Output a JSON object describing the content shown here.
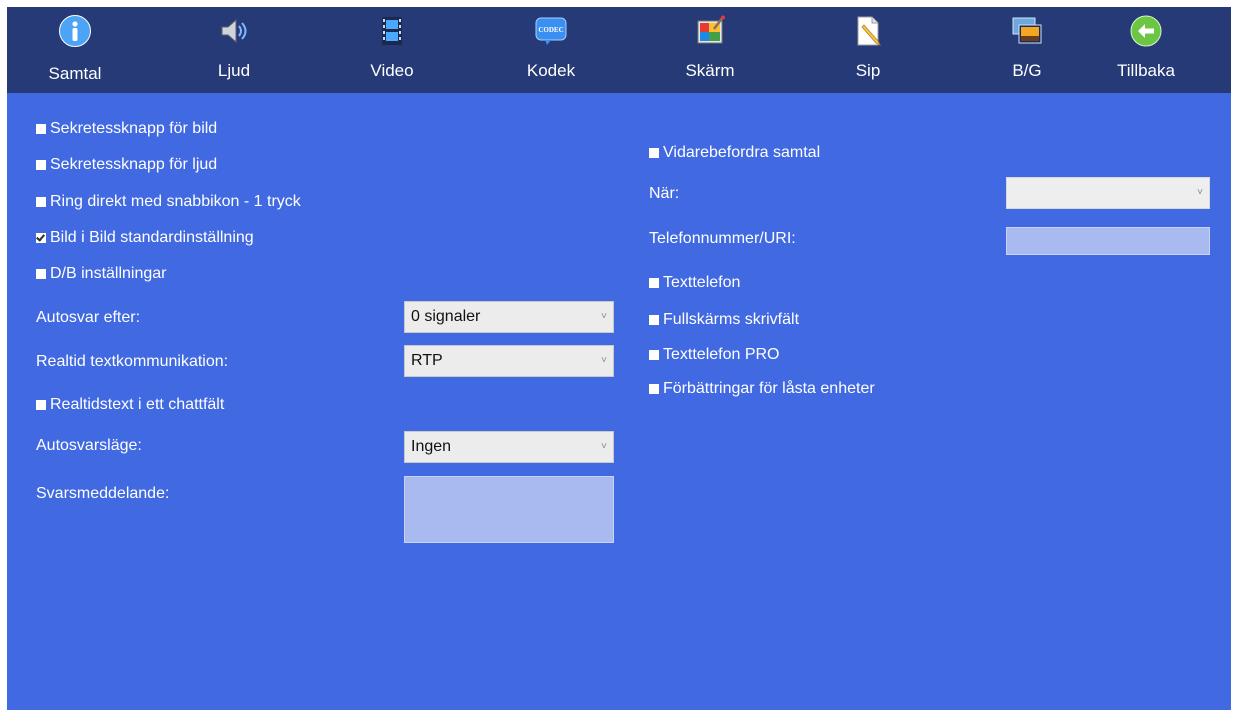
{
  "nav": {
    "items": [
      {
        "label": "Samtal",
        "icon": "info-icon"
      },
      {
        "label": "Ljud",
        "icon": "speaker-icon"
      },
      {
        "label": "Video",
        "icon": "film-icon"
      },
      {
        "label": "Kodek",
        "icon": "codec-icon",
        "icon_text": "CODEC"
      },
      {
        "label": "Skärm",
        "icon": "screen-icon"
      },
      {
        "label": "Sip",
        "icon": "document-pencil-icon"
      },
      {
        "label": "B/G",
        "icon": "background-image-icon"
      },
      {
        "label": "Tillbaka",
        "icon": "back-arrow-icon"
      }
    ]
  },
  "left": {
    "privacy_video": {
      "label": "Sekretessknapp för bild",
      "checked": false
    },
    "privacy_audio": {
      "label": "Sekretessknapp för ljud",
      "checked": false
    },
    "speed_dial": {
      "label": "Ring direkt med snabbikon - 1 tryck",
      "checked": false
    },
    "pip_default": {
      "label": "Bild i Bild standardinställning",
      "checked": true
    },
    "db_settings": {
      "label": "D/B inställningar",
      "checked": false
    },
    "autoanswer_after": {
      "label": "Autosvar efter:",
      "value": "0 signaler"
    },
    "realtime_text": {
      "label": "Realtid textkommunikation:",
      "value": "RTP"
    },
    "rtt_chat": {
      "label": "Realtidstext i ett chattfält",
      "checked": false
    },
    "autoanswer_mode": {
      "label": "Autosvarsläge:",
      "value": "Ingen"
    },
    "answer_message": {
      "label": "Svarsmeddelande:",
      "value": ""
    }
  },
  "right": {
    "forward_calls": {
      "label": "Vidarebefordra samtal",
      "checked": false
    },
    "when": {
      "label": "När:",
      "value": ""
    },
    "phone_uri": {
      "label": "Telefonnummer/URI:",
      "value": ""
    },
    "text_phone": {
      "label": "Texttelefon",
      "checked": false
    },
    "fullscreen_input": {
      "label": "Fullskärms skrivfält",
      "checked": false
    },
    "text_phone_pro": {
      "label": "Texttelefon PRO",
      "checked": false
    },
    "locked_devices": {
      "label": "Förbättringar för låsta enheter",
      "checked": false
    }
  },
  "colors": {
    "topbar": "#253a76",
    "content_background": "#4169e1",
    "input_fill": "#a9baf0"
  }
}
